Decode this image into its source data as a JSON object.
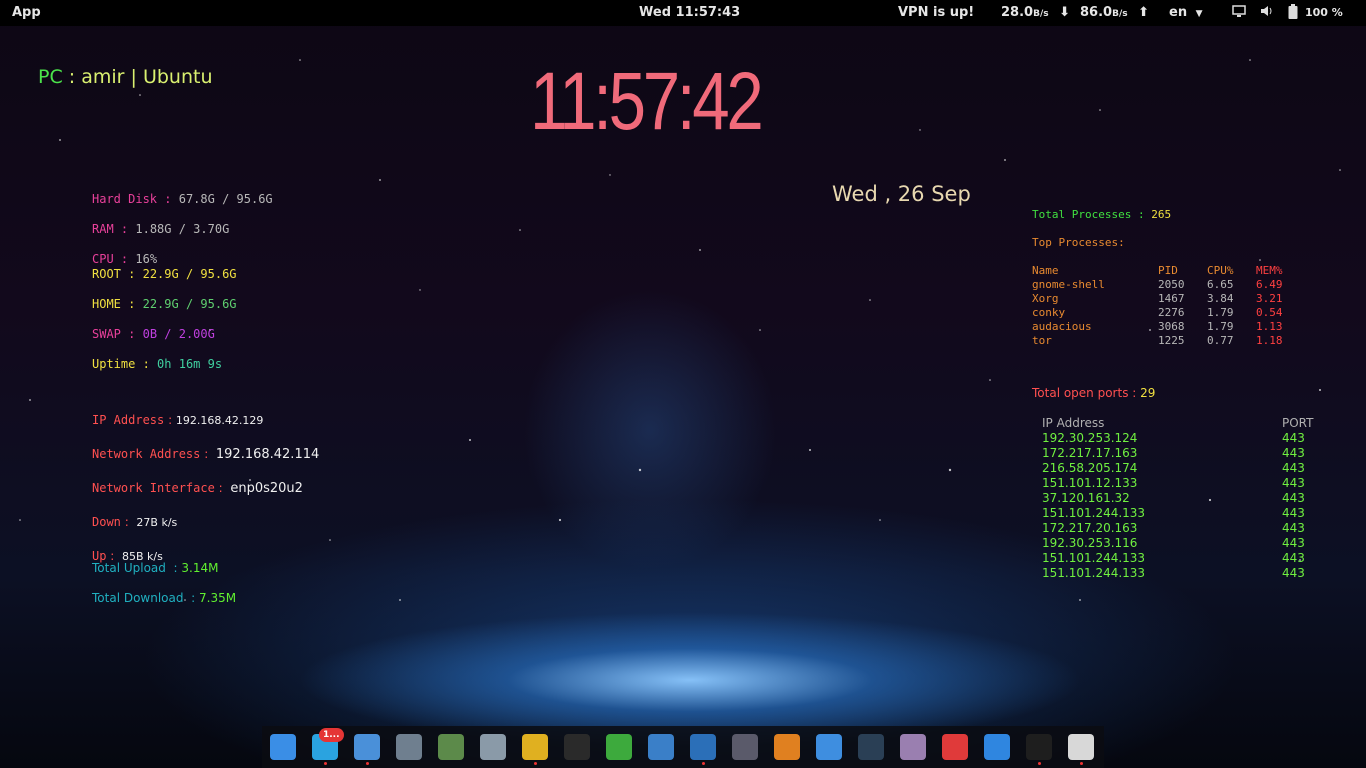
{
  "topbar": {
    "app_label": "App",
    "clock": "Wed 11:57:43",
    "vpn": "VPN is up!",
    "down_value": "28.0",
    "down_unit": "B/s",
    "up_value": "86.0",
    "up_unit": "B/s",
    "lang": "en",
    "battery": "100 %"
  },
  "desktop": {
    "pc_prefix": "PC",
    "pc_rest": ": amir | Ubuntu",
    "big_clock": "11:57:42",
    "date": "Wed , 26  Sep"
  },
  "system": {
    "hard_disk_label": "Hard Disk",
    "hard_disk_value": "67.8G / 95.6G",
    "ram_label": "RAM",
    "ram_value": "1.88G / 3.70G",
    "cpu_label": "CPU",
    "cpu_value": "16%",
    "root_label": "ROOT",
    "root_value": "22.9G / 95.6G",
    "home_label": "HOME",
    "home_value": "22.9G / 95.6G",
    "swap_label": "SWAP",
    "swap_value": "0B / 2.00G",
    "uptime_label": "Uptime",
    "uptime_value": "0h 16m 9s"
  },
  "network": {
    "ip_label": "IP Address",
    "ip_value": "192.168.42.129",
    "netaddr_label": "Network Address",
    "netaddr_value": "192.168.42.114",
    "iface_label": "Network Interface",
    "iface_value": "enp0s20u2",
    "down_label": "Down",
    "down_value": "27B k/s",
    "up_label": "Up",
    "up_value": "85B k/s",
    "total_upload_label": "Total Upload",
    "total_upload_value": "3.14M",
    "total_download_label": "Total Download",
    "total_download_value": "7.35M"
  },
  "processes": {
    "total_label": "Total Processes",
    "total_value": "265",
    "top_label": "Top Processes:",
    "headers": [
      "Name",
      "PID",
      "CPU%",
      "MEM%"
    ],
    "rows": [
      [
        "gnome-shell",
        "2050",
        "6.65",
        "6.49"
      ],
      [
        "Xorg",
        "1467",
        "3.84",
        "3.21"
      ],
      [
        "conky",
        "2276",
        "1.79",
        "0.54"
      ],
      [
        "audacious",
        "3068",
        "1.79",
        "1.13"
      ],
      [
        "tor",
        "1225",
        "0.77",
        "1.18"
      ]
    ]
  },
  "ports": {
    "total_label": "Total open ports",
    "total_value": "29",
    "header_ip": "IP Address",
    "header_port": "PORT",
    "rows": [
      [
        "192.30.253.124",
        "443"
      ],
      [
        "172.217.17.163",
        "443"
      ],
      [
        "216.58.205.174",
        "443"
      ],
      [
        "151.101.12.133",
        "443"
      ],
      [
        "37.120.161.32",
        "443"
      ],
      [
        "151.101.244.133",
        "443"
      ],
      [
        "172.217.20.163",
        "443"
      ],
      [
        "192.30.253.116",
        "443"
      ],
      [
        "151.101.244.133",
        "443"
      ],
      [
        "151.101.244.133",
        "443"
      ]
    ]
  },
  "dock": {
    "telegram_badge": "1...",
    "items": [
      {
        "name": "software-updater-icon",
        "color": "#3a8ee6"
      },
      {
        "name": "telegram-icon",
        "color": "#2aa3e0"
      },
      {
        "name": "files-icon",
        "color": "#4a90d9"
      },
      {
        "name": "webcam-icon",
        "color": "#6f7f8f"
      },
      {
        "name": "calculator-icon",
        "color": "#5c8a4a"
      },
      {
        "name": "disks-icon",
        "color": "#8a9aa8"
      },
      {
        "name": "chrome-icon",
        "color": "#e0b020"
      },
      {
        "name": "inkscape-icon",
        "color": "#2a2a2a"
      },
      {
        "name": "libreoffice-calc-icon",
        "color": "#3daa3d"
      },
      {
        "name": "video-editor-icon",
        "color": "#3a7fc8"
      },
      {
        "name": "vscode-icon",
        "color": "#2b6fb8"
      },
      {
        "name": "wps-icon",
        "color": "#5a5a6a"
      },
      {
        "name": "media-player-icon",
        "color": "#e08020"
      },
      {
        "name": "cloud-app-icon",
        "color": "#3e8ee0"
      },
      {
        "name": "steam-icon",
        "color": "#2a3f55"
      },
      {
        "name": "music-app-icon",
        "color": "#9a7fb0"
      },
      {
        "name": "tool-app-icon",
        "color": "#e03a3a"
      },
      {
        "name": "video-player-icon",
        "color": "#2f86e0"
      },
      {
        "name": "terminal-icon",
        "color": "#1e1e1e"
      },
      {
        "name": "cassette-icon",
        "color": "#d8d8d8"
      }
    ]
  },
  "colors": {
    "clock": "#f06a7a",
    "pc_green": "#4be34b",
    "pc_text": "#d9f070",
    "label_pink": "#e8409a",
    "value_gray": "#b8b8b8",
    "label_yellow": "#f0e040",
    "label_red": "#ff5050",
    "value_white": "#f0f0f0",
    "label_cyan": "#20b0c0",
    "value_green": "#60f030",
    "proc_green": "#40e040",
    "proc_orange": "#e88a30",
    "ports_green": "#70f040",
    "ports_header": "#b0b0b0"
  }
}
